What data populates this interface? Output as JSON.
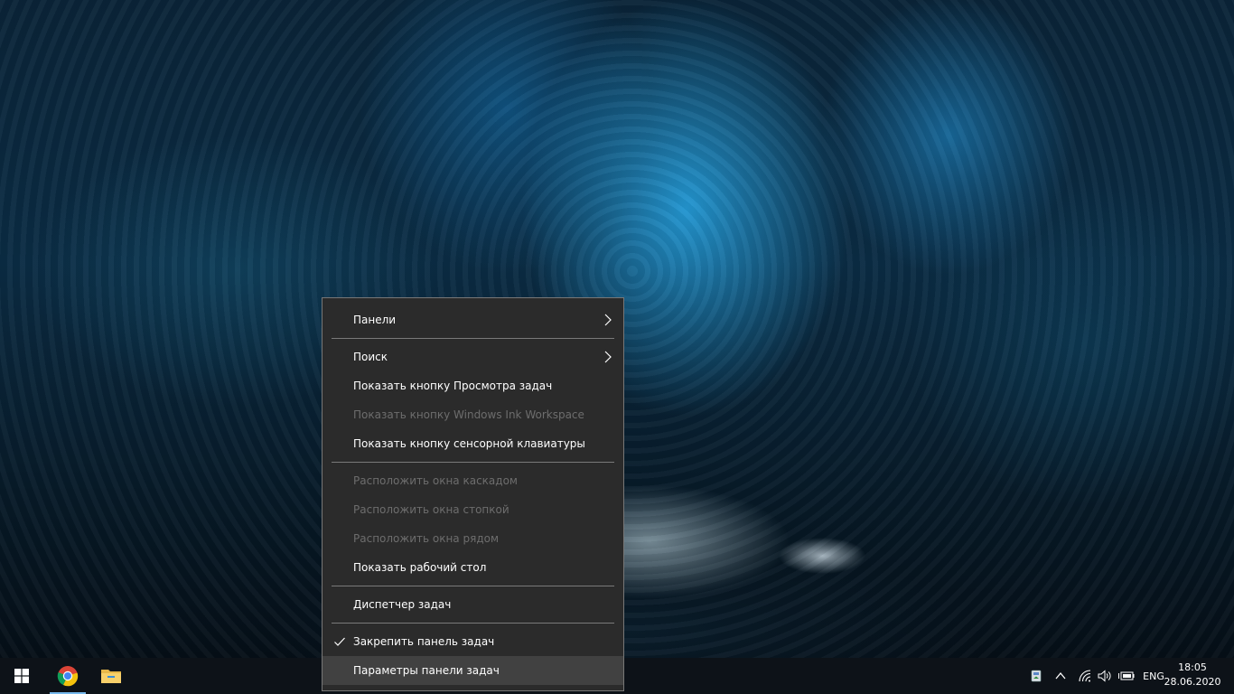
{
  "context_menu": {
    "items": [
      {
        "label": "Панели",
        "submenu": true,
        "enabled": true
      },
      {
        "label": "Поиск",
        "submenu": true,
        "enabled": true
      },
      {
        "label": "Показать кнопку Просмотра задач",
        "enabled": true
      },
      {
        "label": "Показать кнопку Windows Ink Workspace",
        "enabled": false
      },
      {
        "label": "Показать кнопку сенсорной клавиатуры",
        "enabled": true
      },
      {
        "label": "Расположить окна каскадом",
        "enabled": false
      },
      {
        "label": "Расположить окна стопкой",
        "enabled": false
      },
      {
        "label": "Расположить окна рядом",
        "enabled": false
      },
      {
        "label": "Показать рабочий стол",
        "enabled": true
      },
      {
        "label": "Диспетчер задач",
        "enabled": true
      },
      {
        "label": "Закрепить панель задач",
        "enabled": true,
        "checked": true
      },
      {
        "label": "Параметры панели задач",
        "enabled": true,
        "highlighted": true
      }
    ]
  },
  "taskbar": {
    "start_icon": "windows-logo-icon",
    "pinned": [
      {
        "name": "chrome-icon",
        "active": true
      },
      {
        "name": "file-explorer-icon",
        "active": false
      }
    ],
    "tray": {
      "icons": [
        "usb-eject-icon",
        "chevron-up-icon",
        "wifi-icon",
        "volume-icon",
        "battery-icon"
      ],
      "language": "ENG",
      "time": "18:05",
      "date": "28.06.2020"
    }
  },
  "colors": {
    "menu_bg": "#2b2b2b",
    "menu_highlight": "#414141",
    "disabled_text": "#6d6d6d",
    "taskbar_bg": "#0d1218",
    "active_indicator": "#76b9ed"
  }
}
